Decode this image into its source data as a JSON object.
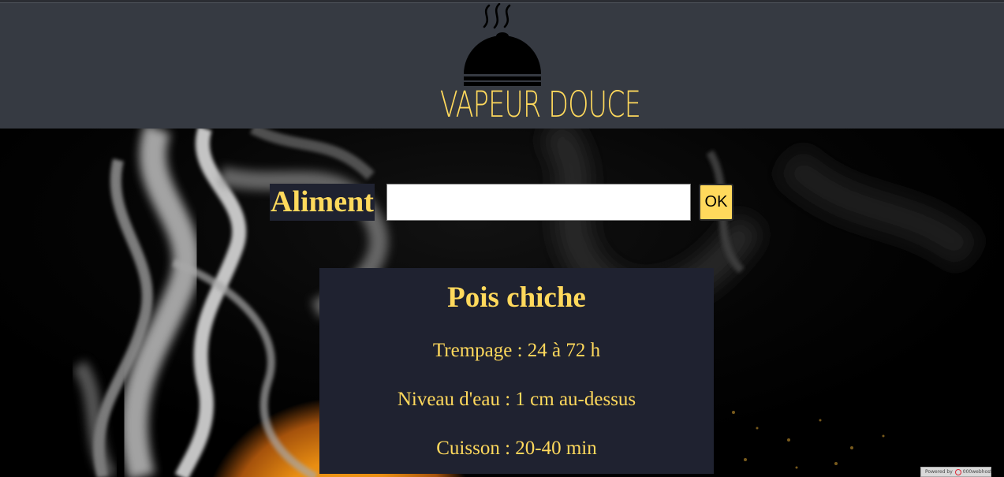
{
  "header": {
    "logo_text": "VAPEUR DOUCE",
    "logo_icon": "cloche-steam-icon"
  },
  "search": {
    "label": "Aliment",
    "value": "",
    "button_label": "OK"
  },
  "result": {
    "title": "Pois chiche",
    "lines": [
      "Trempage : 24 à 72 h",
      "Niveau d'eau : 1 cm au-dessus",
      "Cuisson : 20-40 min"
    ]
  },
  "footer_badge": {
    "powered_text": "Powered by",
    "brand_text": "000webhost",
    "icon": "000webhost-logo-icon"
  },
  "colors": {
    "header_bg": "#363a42",
    "accent": "#ffd95c",
    "card_bg": "#1f2230"
  }
}
